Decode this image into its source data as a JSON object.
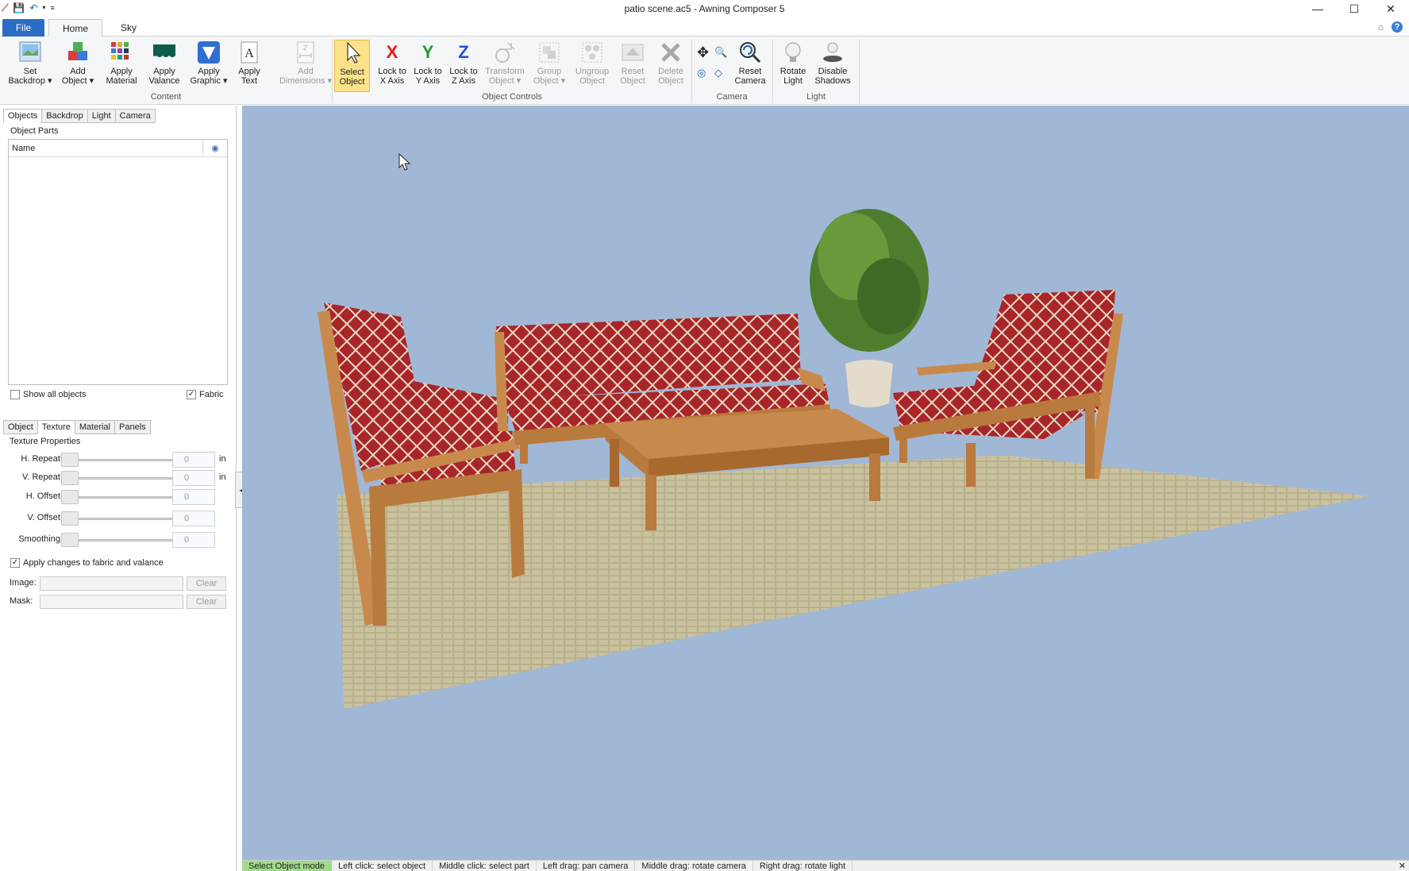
{
  "window": {
    "title": "patio scene.ac5 - Awning Composer 5",
    "minimize": "—",
    "maximize": "☐",
    "close": "✕"
  },
  "ribbon_tabs": {
    "file": "File",
    "home": "Home",
    "sky": "Sky"
  },
  "ribbon": {
    "content": {
      "label": "Content",
      "set_backdrop": [
        "Set",
        "Backdrop ▾"
      ],
      "add_object": [
        "Add",
        "Object ▾"
      ],
      "apply_material": [
        "Apply",
        "Material"
      ],
      "apply_valance": [
        "Apply",
        "Valance"
      ],
      "apply_graphic": [
        "Apply",
        "Graphic ▾"
      ],
      "apply_text": [
        "Apply",
        "Text"
      ],
      "add_dimensions": [
        "Add",
        "Dimensions ▾"
      ]
    },
    "object_controls": {
      "label": "Object Controls",
      "select_object": [
        "Select",
        "Object"
      ],
      "lock_x": [
        "Lock to",
        "X Axis"
      ],
      "lock_y": [
        "Lock to",
        "Y Axis"
      ],
      "lock_z": [
        "Lock to",
        "Z Axis"
      ],
      "transform_object": [
        "Transform",
        "Object ▾"
      ],
      "group_object": [
        "Group",
        "Object ▾"
      ],
      "ungroup_object": [
        "Ungroup",
        "Object"
      ],
      "reset_object": [
        "Reset",
        "Object"
      ],
      "delete_object": [
        "Delete",
        "Object"
      ]
    },
    "camera": {
      "label": "Camera",
      "reset_camera": [
        "Reset",
        "Camera"
      ]
    },
    "light": {
      "label": "Light",
      "rotate_light": [
        "Rotate",
        "Light"
      ],
      "disable_shadows": [
        "Disable",
        "Shadows"
      ]
    }
  },
  "left_panel": {
    "top_tabs": [
      "Objects",
      "Backdrop",
      "Light",
      "Camera"
    ],
    "object_parts_label": "Object Parts",
    "list_header_name": "Name",
    "show_all_objects": "Show all objects",
    "fabric": "Fabric",
    "bottom_tabs": [
      "Object",
      "Texture",
      "Material",
      "Panels"
    ],
    "texture_properties_label": "Texture Properties",
    "sliders": [
      {
        "label": "H. Repeat:",
        "value": "0",
        "unit": "in"
      },
      {
        "label": "V. Repeat:",
        "value": "0",
        "unit": "in"
      },
      {
        "label": "H. Offset:",
        "value": "0",
        "unit": ""
      },
      {
        "label": "V. Offset:",
        "value": "0",
        "unit": ""
      },
      {
        "label": "Smoothing:",
        "value": "0",
        "unit": ""
      }
    ],
    "apply_changes": "Apply changes to fabric and valance",
    "image_label": "Image:",
    "mask_label": "Mask:",
    "clear": "Clear"
  },
  "status_bar": {
    "mode": "Select Object mode",
    "hints": [
      "Left click: select object",
      "Middle click: select part",
      "Left drag: pan camera",
      "Middle drag: rotate camera",
      "Right drag: rotate light"
    ],
    "close": "✕"
  },
  "colors": {
    "viewport_bg": "#a1b7d6",
    "file_tab": "#2b6cc4",
    "selected_tool": "#fde28a",
    "fabric_red": "#a8262a",
    "teak": "#c88a4c",
    "status_mode": "#9fdc8a"
  }
}
